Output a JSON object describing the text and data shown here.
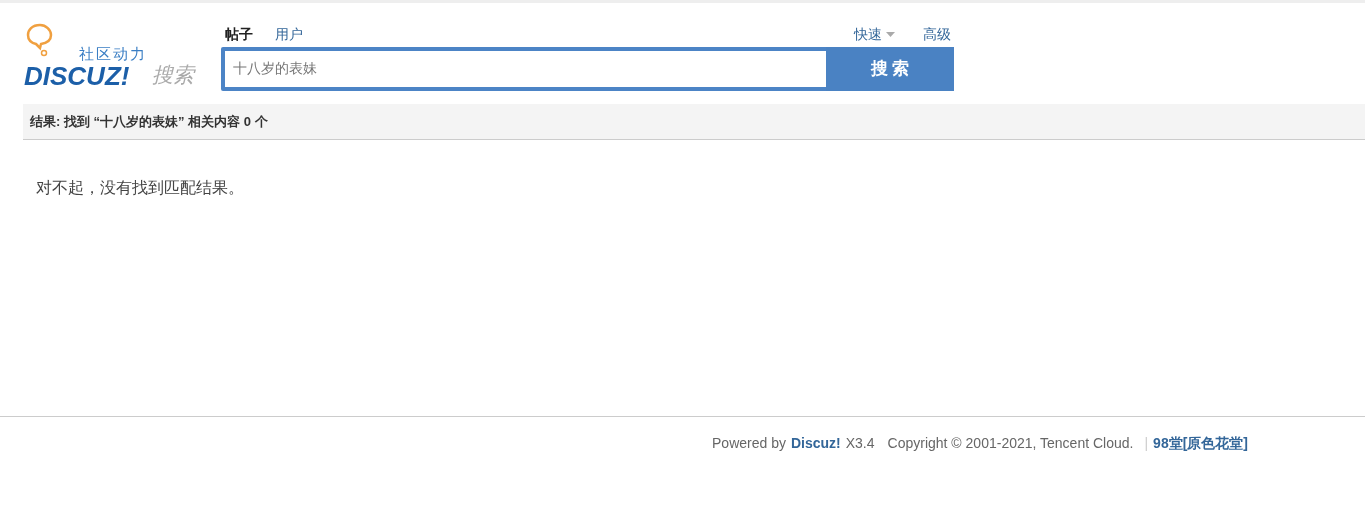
{
  "logo": {
    "tagline": "社区动力",
    "brand": "DISCUZ!",
    "suffix": "搜索"
  },
  "tabs": [
    {
      "label": "帖子",
      "selected": true
    },
    {
      "label": "用户",
      "selected": false
    }
  ],
  "search": {
    "value": "十八岁的表妹",
    "button": "搜 索"
  },
  "options": {
    "quick": "快速",
    "advanced": "高级"
  },
  "result_summary": "结果: 找到 “十八岁的表妹” 相关内容 0 个",
  "message": "对不起，没有找到匹配结果。",
  "footer": {
    "powered": "Powered by",
    "brand": "Discuz!",
    "version": "X3.4",
    "copyright": "Copyright © 2001-2021, Tencent Cloud.",
    "separator": "|",
    "site": "98堂[原色花堂]"
  }
}
